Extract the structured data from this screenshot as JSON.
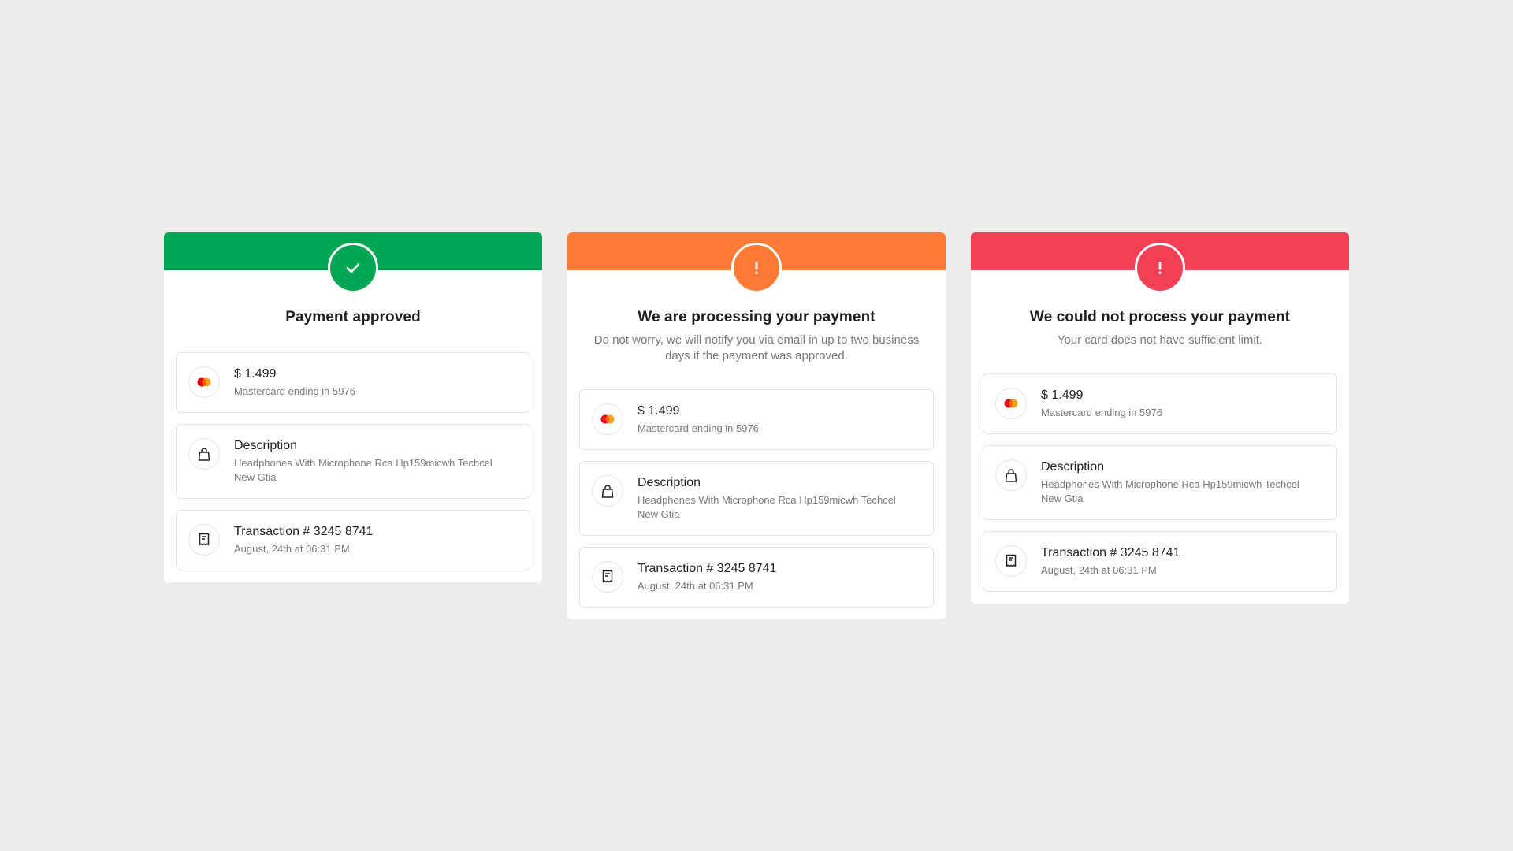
{
  "colors": {
    "background": "#EDEDED",
    "success": "#00A651",
    "processing": "#FF7A35",
    "error": "#F23F53",
    "mastercard_red": "#EB001B",
    "mastercard_orange": "#F79E1B"
  },
  "cards": [
    {
      "status": "approved",
      "status_icon": "check-icon",
      "accent": "#00A651",
      "title": "Payment approved",
      "subtitle": null,
      "details": [
        {
          "icon": "mastercard-icon",
          "primary": "$ 1.499",
          "secondary": "Mastercard ending in 5976"
        },
        {
          "icon": "shopping-bag-icon",
          "primary": "Description",
          "secondary": "Headphones With Microphone Rca Hp159micwh Techcel New Gtia"
        },
        {
          "icon": "receipt-icon",
          "primary": "Transaction # 3245 8741",
          "secondary": "August, 24th at 06:31 PM"
        }
      ]
    },
    {
      "status": "processing",
      "status_icon": "exclamation-icon",
      "accent": "#FF7A35",
      "title": "We are processing your payment",
      "subtitle": "Do not worry, we will notify you via email in up to two business days if the payment was approved.",
      "details": [
        {
          "icon": "mastercard-icon",
          "primary": "$ 1.499",
          "secondary": "Mastercard ending in 5976"
        },
        {
          "icon": "shopping-bag-icon",
          "primary": "Description",
          "secondary": "Headphones With Microphone Rca Hp159micwh Techcel New Gtia"
        },
        {
          "icon": "receipt-icon",
          "primary": "Transaction # 3245 8741",
          "secondary": "August, 24th at 06:31 PM"
        }
      ]
    },
    {
      "status": "rejected",
      "status_icon": "exclamation-icon",
      "accent": "#F23F53",
      "title": "We could not process your payment",
      "subtitle": "Your card does not have sufficient limit.",
      "details": [
        {
          "icon": "mastercard-icon",
          "primary": "$ 1.499",
          "secondary": "Mastercard ending in 5976"
        },
        {
          "icon": "shopping-bag-icon",
          "primary": "Description",
          "secondary": "Headphones With Microphone Rca Hp159micwh Techcel New Gtia"
        },
        {
          "icon": "receipt-icon",
          "primary": "Transaction # 3245 8741",
          "secondary": "August, 24th at 06:31 PM"
        }
      ]
    }
  ]
}
